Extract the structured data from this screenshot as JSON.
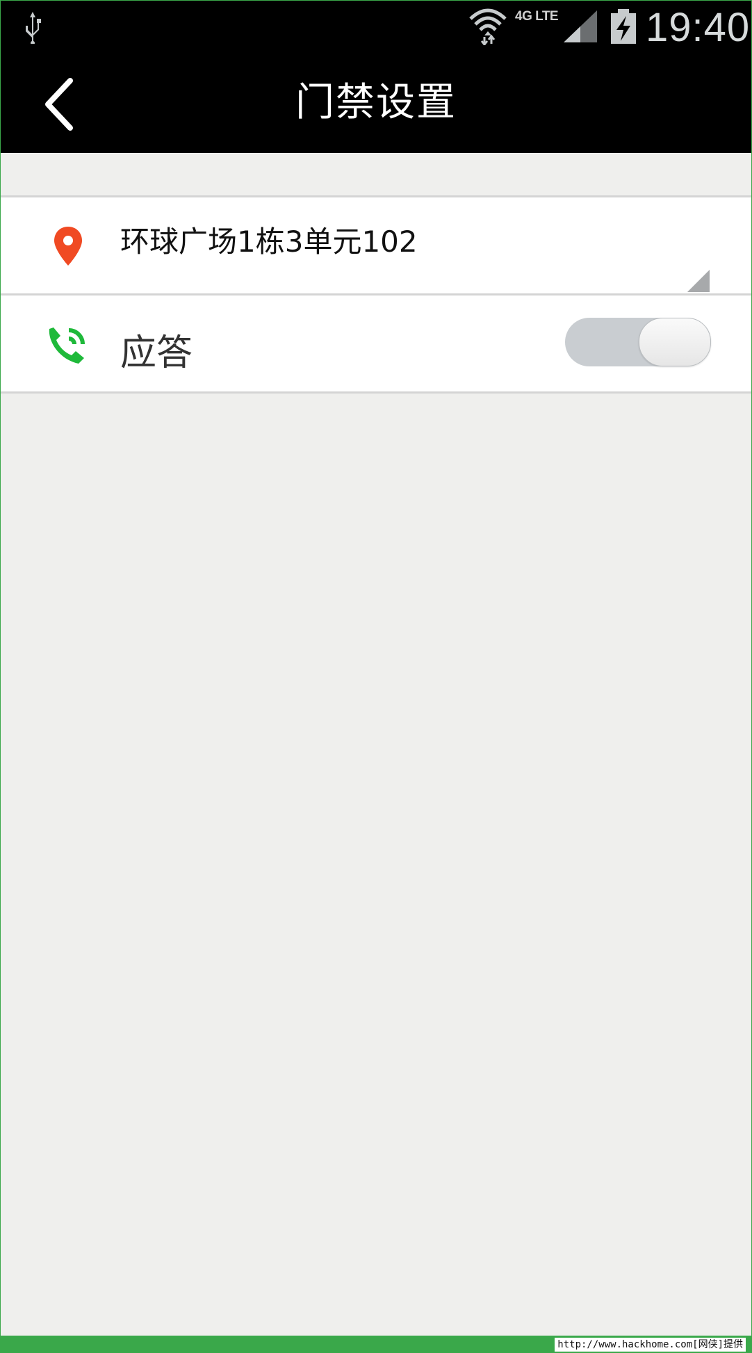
{
  "status_bar": {
    "network_label": "4G LTE",
    "time": "19:40",
    "icons": [
      "usb-icon",
      "wifi-icon",
      "signal-icon",
      "battery-charging-icon"
    ]
  },
  "title_bar": {
    "title": "门禁设置",
    "back_icon": "chevron-left-icon"
  },
  "settings": {
    "address": {
      "icon": "location-pin-icon",
      "icon_color": "#f04a23",
      "value": "环球广场1栋3单元102"
    },
    "answer": {
      "icon": "phone-ringing-icon",
      "icon_color": "#1fb93a",
      "label": "应答",
      "toggle_on": false
    }
  },
  "watermark": "http://www.hackhome.com[网侠]提供"
}
